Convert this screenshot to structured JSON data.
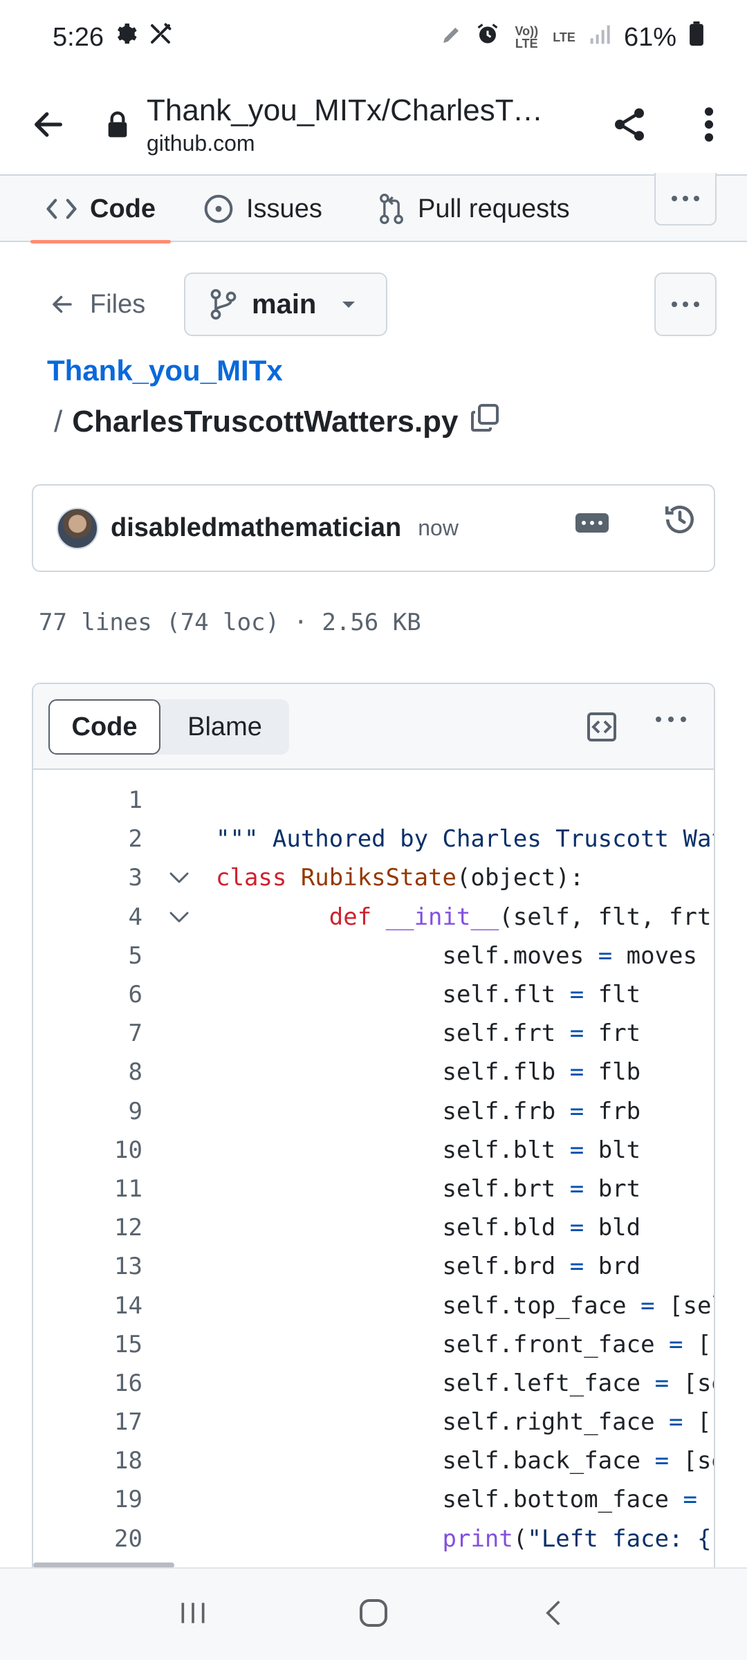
{
  "status_bar": {
    "time": "5:26",
    "battery": "61%",
    "volte_label": "Vo)) LTE",
    "lte_label": "LTE"
  },
  "browser": {
    "page_title": "Thank_you_MITx/CharlesTr…",
    "domain": "github.com"
  },
  "repo_nav": {
    "tabs": [
      {
        "label": "Code",
        "icon": "code-icon",
        "active": true
      },
      {
        "label": "Issues",
        "icon": "issue-opened-icon",
        "active": false
      },
      {
        "label": "Pull requests",
        "icon": "git-pull-request-icon",
        "active": false
      }
    ]
  },
  "files_row": {
    "files_label": "Files",
    "branch": "main"
  },
  "breadcrumb": {
    "repo": "Thank_you_MITx",
    "separator": "/",
    "filename": "CharlesTruscottWatters.py"
  },
  "commit": {
    "author": "disabledmathematician",
    "time": "now"
  },
  "file_stats": "77 lines (74 loc) · 2.56 KB",
  "code_view": {
    "code_tab": "Code",
    "blame_tab": "Blame",
    "lines": [
      {
        "n": "1",
        "fold": false,
        "segments": []
      },
      {
        "n": "2",
        "fold": false,
        "segments": [
          {
            "t": "\"\"\" Authored by Charles Truscott Wat",
            "c": "str"
          }
        ]
      },
      {
        "n": "3",
        "fold": true,
        "segments": [
          {
            "t": "class ",
            "c": "kw"
          },
          {
            "t": "RubiksState",
            "c": "cls"
          },
          {
            "t": "(object):",
            "c": ""
          }
        ]
      },
      {
        "n": "4",
        "fold": true,
        "segments": [
          {
            "t": "        def ",
            "c": "kw"
          },
          {
            "t": "__init__",
            "c": "fn"
          },
          {
            "t": "(self, flt, frt,",
            "c": ""
          }
        ]
      },
      {
        "n": "5",
        "fold": false,
        "segments": [
          {
            "t": "                self.moves ",
            "c": ""
          },
          {
            "t": "=",
            "c": "op"
          },
          {
            "t": " moves",
            "c": ""
          }
        ]
      },
      {
        "n": "6",
        "fold": false,
        "segments": [
          {
            "t": "                self.flt ",
            "c": ""
          },
          {
            "t": "=",
            "c": "op"
          },
          {
            "t": " flt",
            "c": ""
          }
        ]
      },
      {
        "n": "7",
        "fold": false,
        "segments": [
          {
            "t": "                self.frt ",
            "c": ""
          },
          {
            "t": "=",
            "c": "op"
          },
          {
            "t": " frt",
            "c": ""
          }
        ]
      },
      {
        "n": "8",
        "fold": false,
        "segments": [
          {
            "t": "                self.flb ",
            "c": ""
          },
          {
            "t": "=",
            "c": "op"
          },
          {
            "t": " flb",
            "c": ""
          }
        ]
      },
      {
        "n": "9",
        "fold": false,
        "segments": [
          {
            "t": "                self.frb ",
            "c": ""
          },
          {
            "t": "=",
            "c": "op"
          },
          {
            "t": " frb",
            "c": ""
          }
        ]
      },
      {
        "n": "10",
        "fold": false,
        "segments": [
          {
            "t": "                self.blt ",
            "c": ""
          },
          {
            "t": "=",
            "c": "op"
          },
          {
            "t": " blt",
            "c": ""
          }
        ]
      },
      {
        "n": "11",
        "fold": false,
        "segments": [
          {
            "t": "                self.brt ",
            "c": ""
          },
          {
            "t": "=",
            "c": "op"
          },
          {
            "t": " brt",
            "c": ""
          }
        ]
      },
      {
        "n": "12",
        "fold": false,
        "segments": [
          {
            "t": "                self.bld ",
            "c": ""
          },
          {
            "t": "=",
            "c": "op"
          },
          {
            "t": " bld",
            "c": ""
          }
        ]
      },
      {
        "n": "13",
        "fold": false,
        "segments": [
          {
            "t": "                self.brd ",
            "c": ""
          },
          {
            "t": "=",
            "c": "op"
          },
          {
            "t": " brd",
            "c": ""
          }
        ]
      },
      {
        "n": "14",
        "fold": false,
        "segments": [
          {
            "t": "                self.top_face ",
            "c": ""
          },
          {
            "t": "=",
            "c": "op"
          },
          {
            "t": " [sel",
            "c": ""
          }
        ]
      },
      {
        "n": "15",
        "fold": false,
        "segments": [
          {
            "t": "                self.front_face ",
            "c": ""
          },
          {
            "t": "=",
            "c": "op"
          },
          {
            "t": " [s",
            "c": ""
          }
        ]
      },
      {
        "n": "16",
        "fold": false,
        "segments": [
          {
            "t": "                self.left_face ",
            "c": ""
          },
          {
            "t": "=",
            "c": "op"
          },
          {
            "t": " [se",
            "c": ""
          }
        ]
      },
      {
        "n": "17",
        "fold": false,
        "segments": [
          {
            "t": "                self.right_face ",
            "c": ""
          },
          {
            "t": "=",
            "c": "op"
          },
          {
            "t": " [s",
            "c": ""
          }
        ]
      },
      {
        "n": "18",
        "fold": false,
        "segments": [
          {
            "t": "                self.back_face ",
            "c": ""
          },
          {
            "t": "=",
            "c": "op"
          },
          {
            "t": " [se",
            "c": ""
          }
        ]
      },
      {
        "n": "19",
        "fold": false,
        "segments": [
          {
            "t": "                self.bottom_face ",
            "c": ""
          },
          {
            "t": "=",
            "c": "op"
          },
          {
            "t": " [",
            "c": ""
          }
        ]
      },
      {
        "n": "20",
        "fold": false,
        "segments": [
          {
            "t": "                ",
            "c": ""
          },
          {
            "t": "print",
            "c": "fn"
          },
          {
            "t": "(",
            "c": ""
          },
          {
            "t": "\"Left face: {}",
            "c": "str"
          }
        ]
      }
    ]
  },
  "colors": {
    "accent_link": "#0969da",
    "tab_underline": "#fd8c73",
    "keyword": "#cf222e",
    "function": "#8250df",
    "operator": "#0550ae",
    "string": "#0a3069"
  }
}
